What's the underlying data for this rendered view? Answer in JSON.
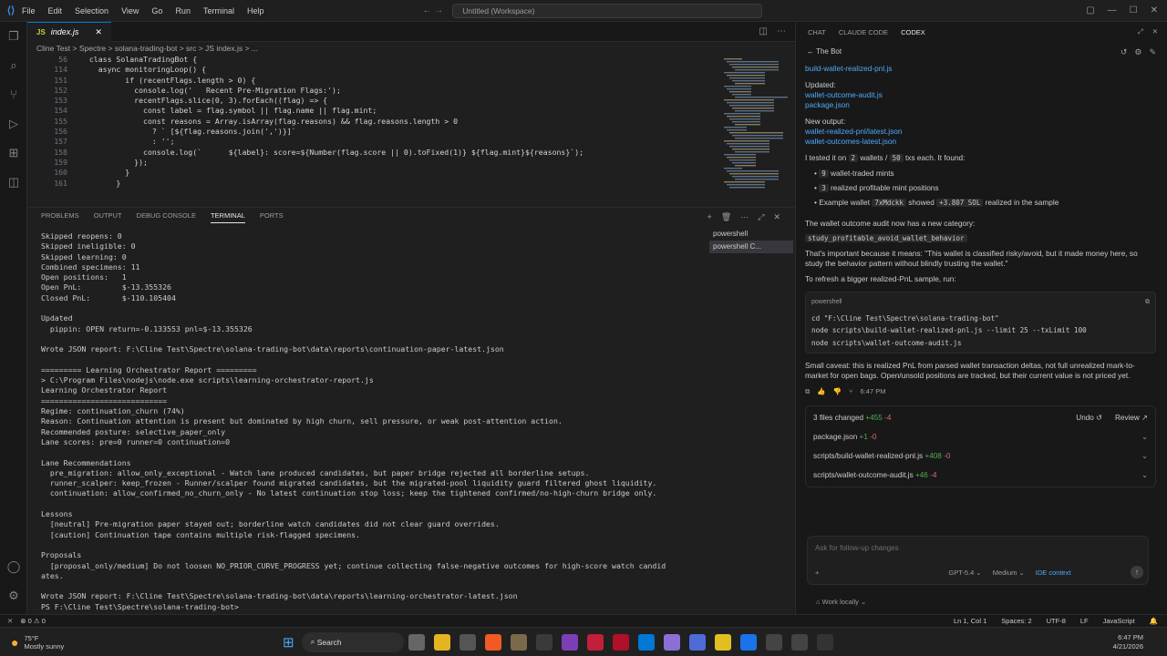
{
  "titlebar": {
    "menu": [
      "File",
      "Edit",
      "Selection",
      "View",
      "Go",
      "Run",
      "Terminal",
      "Help"
    ],
    "search": "Untitled (Workspace)"
  },
  "editor": {
    "tab": "index.js",
    "breadcrumb": "Cline Test > Spectre > solana-trading-bot > src > JS index.js > ...",
    "lines": [
      {
        "n": "56",
        "t": "  class SolanaTradingBot {"
      },
      {
        "n": "114",
        "t": "    async monitoringLoop() {"
      },
      {
        "n": "151",
        "t": "          if (recentFlags.length > 0) {"
      },
      {
        "n": "152",
        "t": "            console.log('   Recent Pre-Migration Flags:');"
      },
      {
        "n": "153",
        "t": "            recentFlags.slice(0, 3).forEach((flag) => {"
      },
      {
        "n": "154",
        "t": "              const label = flag.symbol || flag.name || flag.mint;"
      },
      {
        "n": "155",
        "t": "              const reasons = Array.isArray(flag.reasons) && flag.reasons.length > 0"
      },
      {
        "n": "156",
        "t": "                ? ` [${flag.reasons.join(',')}]`"
      },
      {
        "n": "157",
        "t": "                : '';"
      },
      {
        "n": "158",
        "t": "              console.log(`      ${label}: score=${Number(flag.score || 0).toFixed(1)} ${flag.mint}${reasons}`);"
      },
      {
        "n": "159",
        "t": "            });"
      },
      {
        "n": "160",
        "t": "          }"
      },
      {
        "n": "161",
        "t": "        }"
      }
    ]
  },
  "panel": {
    "tabs": [
      "PROBLEMS",
      "OUTPUT",
      "DEBUG CONSOLE",
      "TERMINAL",
      "PORTS"
    ],
    "active_tab": "TERMINAL",
    "terminals": [
      "powershell",
      "powershell  C..."
    ],
    "output": "Skipped reopens: 0\nSkipped ineligible: 0\nSkipped learning: 0\nCombined specimens: 11\nOpen positions:   1\nOpen PnL:         $-13.355326\nClosed PnL:       $-110.105404\n\nUpdated\n  pippin: OPEN return=-0.133553 pnl=$-13.355326\n\nWrote JSON report: F:\\Cline Test\\Spectre\\solana-trading-bot\\data\\reports\\continuation-paper-latest.json\n\n========= Learning Orchestrator Report =========\n> C:\\Program Files\\nodejs\\node.exe scripts\\learning-orchestrator-report.js\nLearning Orchestrator Report\n============================\nRegime: continuation_churn (74%)\nReason: Continuation attention is present but dominated by high churn, sell pressure, or weak post-attention action.\nRecommended posture: selective_paper_only\nLane scores: pre=0 runner=0 continuation=0\n\nLane Recommendations\n  pre_migration: allow_only_exceptional - Watch lane produced candidates, but paper bridge rejected all borderline setups.\n  runner_scalper: keep_frozen - Runner/scalper found migrated candidates, but the migrated-pool liquidity guard filtered ghost liquidity.\n  continuation: allow_confirmed_no_churn_only - No latest continuation stop loss; keep the tightened confirmed/no-high-churn bridge only.\n\nLessons\n  [neutral] Pre-migration paper stayed out; borderline watch candidates did not clear guard overrides.\n  [caution] Continuation tape contains multiple risk-flagged specimens.\n\nProposals\n  [proposal_only/medium] Do not loosen NO_PRIOR_CURVE_PROGRESS yet; continue collecting false-negative outcomes for high-score watch candid\nates.\n\nWrote JSON report: F:\\Cline Test\\Spectre\\solana-trading-bot\\data\\reports\\learning-orchestrator-latest.json\nPS F:\\Cline Test\\Spectre\\solana-trading-bot> "
  },
  "chat": {
    "tabs": [
      "CHAT",
      "CLAUDE CODE",
      "CODEX"
    ],
    "active_tab": "CODEX",
    "thread": "The Bot",
    "file_top": "build-wallet-realized-pnl.js",
    "updated_label": "Updated:",
    "updated": [
      "wallet-outcome-audit.js",
      "package.json"
    ],
    "new_output_label": "New output:",
    "new_output": [
      "wallet-realized-pnl/latest.json",
      "wallet-outcomes-latest.json"
    ],
    "tested": {
      "a": "I tested it on",
      "w": "2",
      "b": "wallets /",
      "t": "50",
      "c": "txs each. It found:"
    },
    "bullets": [
      {
        "code": "9",
        "text": "wallet-traded mints"
      },
      {
        "code": "3",
        "text": "realized profitable mint positions"
      }
    ],
    "example": {
      "a": "Example wallet",
      "w": "7xMdckk",
      "b": "showed",
      "v": "+3.807 SOL",
      "c": "realized in the sample"
    },
    "category_text": "The wallet outcome audit now has a new category:",
    "category": "study_profitable_avoid_wallet_behavior",
    "important": "That's important because it means: \"This wallet is classified risky/avoid, but it made money here, so study the behavior pattern without blindly trusting the wallet.\"",
    "refresh": "To refresh a bigger realized-PnL sample, run:",
    "shell": "powershell",
    "commands": [
      "cd \"F:\\Cline Test\\Spectre\\solana-trading-bot\"",
      "node scripts\\build-wallet-realized-pnl.js --limit 25 --txLimit 100",
      "node scripts\\wallet-outcome-audit.js"
    ],
    "caveat": "Small caveat: this is realized PnL from parsed wallet transaction deltas, not full unrealized mark-to-market for open bags. Open/unsold positions are tracked, but their current value is not priced yet.",
    "time": "6:47 PM",
    "changes": {
      "title": "3 files changed",
      "add": "+455",
      "del": "-4",
      "undo": "Undo",
      "review": "Review",
      "files": [
        {
          "name": "package.json",
          "add": "+1",
          "del": "-0"
        },
        {
          "name": "scripts/build-wallet-realized-pnl.js",
          "add": "+408",
          "del": "-0"
        },
        {
          "name": "scripts/wallet-outcome-audit.js",
          "add": "+46",
          "del": "-4"
        }
      ]
    },
    "placeholder": "Ask for follow-up changes",
    "model": "GPT-5.4",
    "effort": "Medium",
    "ide": "IDE context",
    "work": "Work locally"
  },
  "status": {
    "position": "Ln 1, Col 1",
    "spaces": "Spaces: 2",
    "encoding": "UTF-8",
    "eol": "LF",
    "lang": "JavaScript",
    "errors": "0",
    "warnings": "0"
  },
  "taskbar": {
    "temp": "75°F",
    "weather": "Mostly sunny",
    "search": "Search",
    "time": "6:47 PM",
    "date": "4/21/2026"
  }
}
